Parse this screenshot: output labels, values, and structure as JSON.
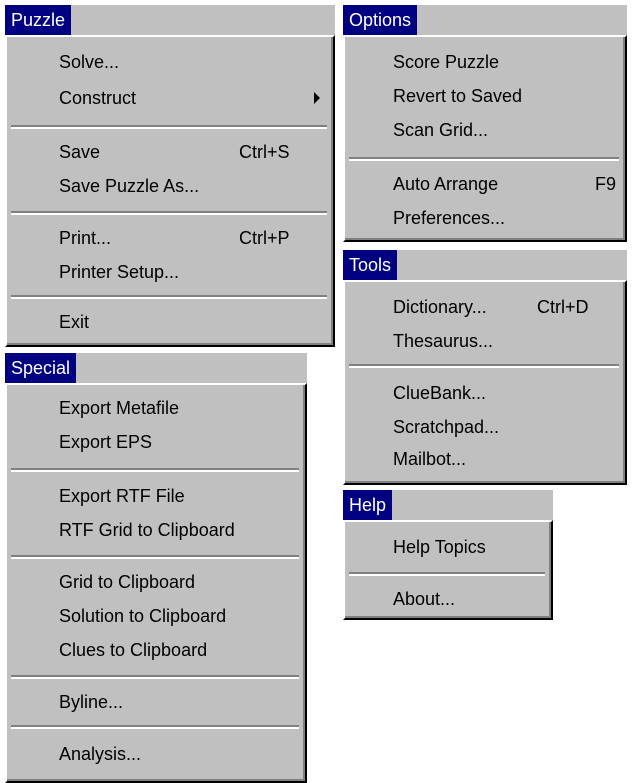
{
  "menus": {
    "puzzle": {
      "title": "Puzzle",
      "items": [
        {
          "label": "Solve...",
          "shortcut": ""
        },
        {
          "label": "Construct",
          "shortcut": "",
          "submenu": true
        },
        {
          "label": "Save",
          "shortcut": "Ctrl+S"
        },
        {
          "label": "Save Puzzle As...",
          "shortcut": ""
        },
        {
          "label": "Print...",
          "shortcut": "Ctrl+P"
        },
        {
          "label": "Printer Setup...",
          "shortcut": ""
        },
        {
          "label": "Exit",
          "shortcut": ""
        }
      ]
    },
    "options": {
      "title": "Options",
      "items": [
        {
          "label": "Score Puzzle",
          "shortcut": ""
        },
        {
          "label": "Revert to Saved",
          "shortcut": ""
        },
        {
          "label": "Scan Grid...",
          "shortcut": ""
        },
        {
          "label": "Auto Arrange",
          "shortcut": "F9"
        },
        {
          "label": "Preferences...",
          "shortcut": ""
        }
      ]
    },
    "tools": {
      "title": "Tools",
      "items": [
        {
          "label": "Dictionary...",
          "shortcut": "Ctrl+D"
        },
        {
          "label": "Thesaurus...",
          "shortcut": ""
        },
        {
          "label": "ClueBank...",
          "shortcut": ""
        },
        {
          "label": "Scratchpad...",
          "shortcut": ""
        },
        {
          "label": "Mailbot...",
          "shortcut": ""
        }
      ]
    },
    "special": {
      "title": "Special",
      "items": [
        {
          "label": "Export Metafile",
          "shortcut": ""
        },
        {
          "label": "Export EPS",
          "shortcut": ""
        },
        {
          "label": "Export RTF File",
          "shortcut": ""
        },
        {
          "label": "RTF Grid to Clipboard",
          "shortcut": ""
        },
        {
          "label": "Grid to Clipboard",
          "shortcut": ""
        },
        {
          "label": "Solution to Clipboard",
          "shortcut": ""
        },
        {
          "label": "Clues to Clipboard",
          "shortcut": ""
        },
        {
          "label": "Byline...",
          "shortcut": ""
        },
        {
          "label": "Analysis...",
          "shortcut": ""
        }
      ]
    },
    "help": {
      "title": "Help",
      "items": [
        {
          "label": "Help Topics",
          "shortcut": ""
        },
        {
          "label": "About...",
          "shortcut": ""
        }
      ]
    }
  },
  "colors": {
    "menu_face": "#c0c0c0",
    "title_highlight": "#000080",
    "title_text": "#ffffff",
    "shadow": "#808080",
    "highlight": "#ffffff"
  }
}
